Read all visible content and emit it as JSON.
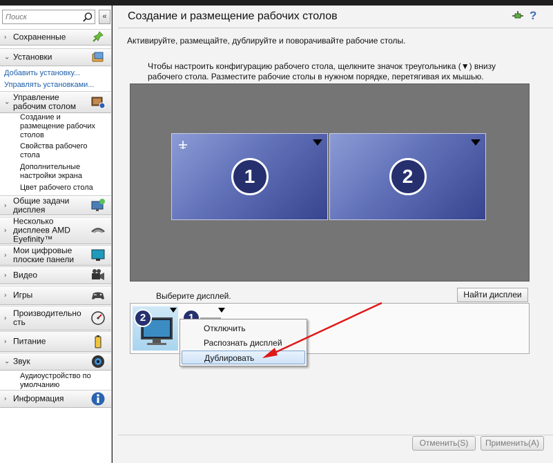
{
  "sidebar": {
    "search_placeholder": "Поиск",
    "collapse_label": "«",
    "sections": {
      "saved": "Сохраненные",
      "presets": "Установки",
      "desktop_mgmt": "Управление рабочим столом",
      "common_display": "Общие задачи дисплея",
      "eyefinity": "Несколько дисплеев AMD Eyefinity™",
      "digital_panels": "Мои цифровые плоские панели",
      "video": "Видео",
      "games": "Игры",
      "performance": "Производительно сть",
      "power": "Питание",
      "sound": "Звук",
      "info": "Информация"
    },
    "preset_links": {
      "add": "Добавить установку...",
      "manage": "Управлять установками..."
    },
    "desktop_sub": {
      "create": "Создание и размещение рабочих столов",
      "properties": "Свойства рабочего стола",
      "advanced": "Дополнительные настройки экрана",
      "color": "Цвет рабочего стола"
    },
    "sound_sub": {
      "default_audio": "Аудиоустройство по умолчанию"
    }
  },
  "main": {
    "title": "Создание и размещение рабочих столов",
    "help_label": "?",
    "description": "Активируйте, размещайте, дублируйте и поворачивайте рабочие столы.",
    "instruction": "Чтобы настроить конфигурацию рабочего стола, щелкните значок треугольника (▼) внизу рабочего стола.  Разместите рабочие столы в нужном порядке, перетягивая их мышью.",
    "monitors": [
      {
        "number": "1"
      },
      {
        "number": "2"
      }
    ],
    "select_label": "Выберите дисплей.",
    "find_button": "Найти дисплеи",
    "tray_tiles": [
      {
        "number": "2"
      },
      {
        "number": "1"
      }
    ],
    "context_menu": {
      "items": [
        "Отключить",
        "Распознать дисплей",
        "Дублировать"
      ],
      "highlighted_index": 2
    },
    "cancel_button": "Отменить(S)",
    "apply_button": "Применить(A)"
  },
  "colors": {
    "accent": "#26306e",
    "annotation_arrow": "#e01818",
    "link": "#1d5fa8"
  }
}
